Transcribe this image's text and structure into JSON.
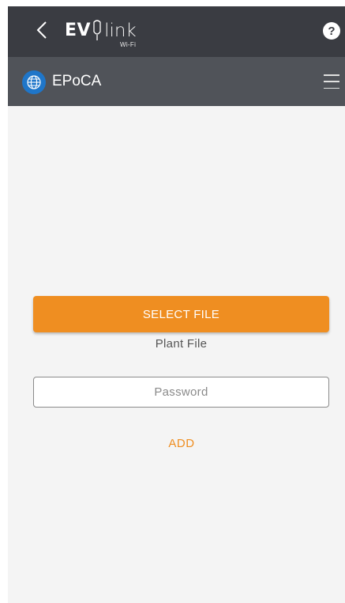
{
  "app": {
    "logo_main": "EV",
    "logo_secondary": "link",
    "logo_sub": "Wi-Fi",
    "help_label": "?"
  },
  "subheader": {
    "title": "EPoCA",
    "icon": "globe-icon"
  },
  "form": {
    "select_file_label": "SELECT FILE",
    "file_label": "Plant File",
    "password_placeholder": "Password",
    "password_value": "",
    "add_label": "ADD"
  },
  "colors": {
    "accent": "#ef8e21",
    "appbar": "#3a3c42",
    "subbar": "#505359",
    "globe": "#1f76c9",
    "background": "#f4f4f4"
  }
}
